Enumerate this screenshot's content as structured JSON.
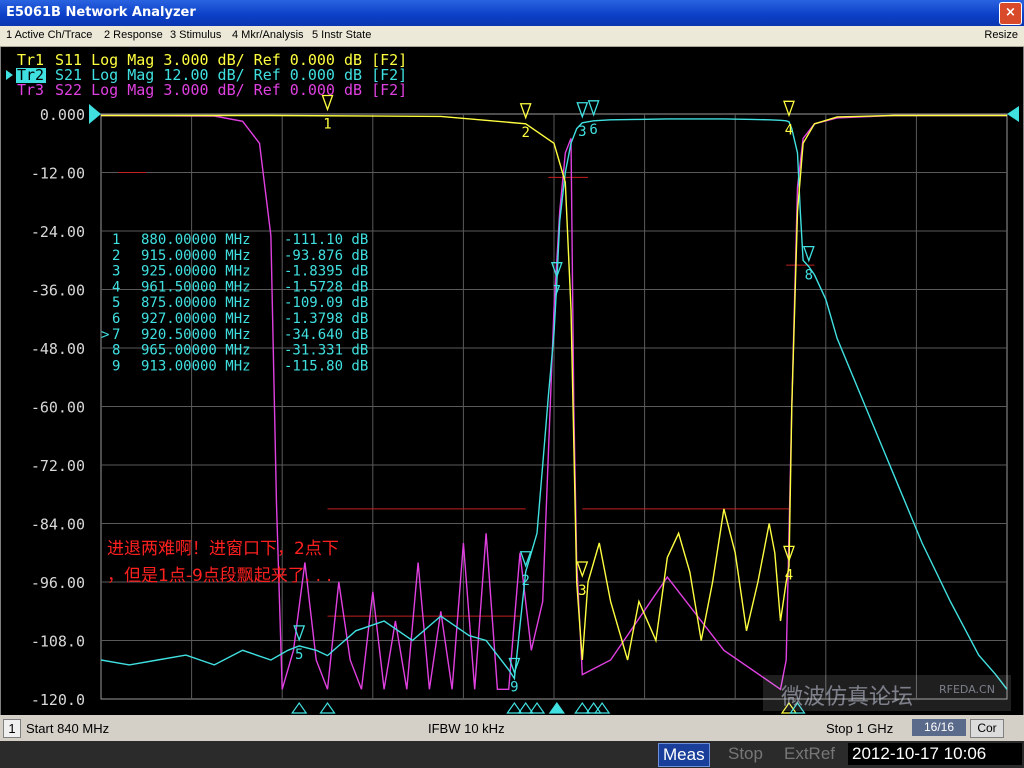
{
  "window": {
    "title": "E5061B Network Analyzer",
    "close_glyph": "×"
  },
  "menu": {
    "items": [
      "1 Active Ch/Trace",
      "2 Response",
      "3 Stimulus",
      "4 Mkr/Analysis",
      "5 Instr State"
    ],
    "resize": "Resize"
  },
  "traces": [
    {
      "id": "Tr1",
      "label": "Tr1 S11 Log Mag 3.000 dB/ Ref 0.000 dB [F2]",
      "color": "#ffff40",
      "active": false
    },
    {
      "id": "Tr2",
      "label": "Tr2 S21 Log Mag 12.00 dB/ Ref 0.000 dB [F2]",
      "color": "#40e0e0",
      "active": true
    },
    {
      "id": "Tr3",
      "label": "Tr3 S22 Log Mag 3.000 dB/ Ref 0.000 dB [F2]",
      "color": "#e040e0",
      "active": false
    }
  ],
  "annotation": {
    "line1": "进退两难啊！进窗口下，2点下",
    "line2": "，但是1点-9点段飘起来了. . .",
    "color": "#ff2020"
  },
  "marker_table": [
    {
      "num": "1",
      "freq": "880.00000 MHz",
      "value": "-111.10 dB",
      "active": false
    },
    {
      "num": "2",
      "freq": "915.00000 MHz",
      "value": "-93.876 dB",
      "active": false
    },
    {
      "num": "3",
      "freq": "925.00000 MHz",
      "value": "-1.8395 dB",
      "active": false
    },
    {
      "num": "4",
      "freq": "961.50000 MHz",
      "value": "-1.5728 dB",
      "active": false
    },
    {
      "num": "5",
      "freq": "875.00000 MHz",
      "value": "-109.09 dB",
      "active": false
    },
    {
      "num": "6",
      "freq": "927.00000 MHz",
      "value": "-1.3798 dB",
      "active": false
    },
    {
      "num": "7",
      "freq": "920.50000 MHz",
      "value": "-34.640 dB",
      "active": true
    },
    {
      "num": "8",
      "freq": "965.00000 MHz",
      "value": "-31.331 dB",
      "active": false
    },
    {
      "num": "9",
      "freq": "913.00000 MHz",
      "value": "-115.80 dB",
      "active": false
    }
  ],
  "channel_bar": {
    "channel": "1",
    "start": "Start 840 MHz",
    "ifbw": "IFBW 10 kHz",
    "stop": "Stop 1 GHz",
    "points": "16/16",
    "cor": "Cor"
  },
  "status_bar": {
    "meas": "Meas",
    "stop": "Stop",
    "extref": "ExtRef",
    "clock": "2012-10-17 10:06"
  },
  "watermark": {
    "text1": "微波仿真论坛",
    "text2": "RFEDA.CN"
  },
  "chart_data": {
    "type": "line",
    "xlim": [
      840,
      1000
    ],
    "x_unit": "MHz",
    "ylim": [
      -120,
      0
    ],
    "ytick_labels": [
      "0.000",
      "-12.00",
      "-24.00",
      "-36.00",
      "-48.00",
      "-60.00",
      "-72.00",
      "-84.00",
      "-96.00",
      "-108.0",
      "-120.0"
    ],
    "grid": true,
    "series": [
      {
        "name": "S21",
        "color": "#40e0e0",
        "x": [
          840,
          845,
          850,
          855,
          860,
          865,
          870,
          873,
          875,
          878,
          880,
          885,
          890,
          895,
          900,
          905,
          908,
          910,
          912,
          913,
          915,
          917,
          918,
          919,
          920,
          920.5,
          921,
          922,
          923,
          924,
          925,
          927,
          930,
          935,
          940,
          945,
          950,
          955,
          958,
          960,
          961,
          961.5,
          962,
          963,
          963.5,
          964,
          965,
          966,
          968,
          970,
          975,
          980,
          985,
          990,
          995,
          998,
          1000
        ],
        "y": [
          -112,
          -113,
          -112,
          -111,
          -113,
          -110,
          -112,
          -110,
          -109.1,
          -110,
          -111.1,
          -106,
          -104,
          -108,
          -103,
          -107,
          -108,
          -111,
          -114,
          -115.8,
          -93.9,
          -86,
          -72,
          -58,
          -45,
          -34.6,
          -22,
          -12,
          -6,
          -3,
          -1.8,
          -1.4,
          -1.2,
          -1.1,
          -1.0,
          -1.0,
          -1.0,
          -1.1,
          -1.2,
          -1.3,
          -1.4,
          -1.6,
          -3,
          -8,
          -20,
          -30,
          -31.3,
          -33,
          -38,
          -46,
          -60,
          -74,
          -88,
          -100,
          -111,
          -115,
          -118
        ]
      },
      {
        "name": "S11",
        "color": "#ffff40",
        "x": [
          840,
          870,
          900,
          915,
          920,
          922,
          923,
          924,
          925,
          926,
          928,
          930,
          933,
          935,
          938,
          940,
          942,
          944,
          946,
          948,
          950,
          952,
          954,
          956,
          958,
          959,
          960,
          961,
          961.5,
          962,
          963,
          964,
          966,
          970,
          980,
          1000
        ],
        "y": [
          -0.3,
          -0.3,
          -0.5,
          -2,
          -6,
          -14,
          -40,
          -96,
          -112,
          -96,
          -88,
          -100,
          -112,
          -100,
          -108,
          -91,
          -86,
          -94,
          -108,
          -96,
          -81,
          -90,
          -106,
          -96,
          -84,
          -90,
          -104,
          -96,
          -92.8,
          -60,
          -20,
          -6,
          -2,
          -0.6,
          -0.3,
          -0.3
        ]
      },
      {
        "name": "S22",
        "color": "#e040e0",
        "x": [
          840,
          860,
          865,
          868,
          870,
          871,
          872,
          874,
          876,
          878,
          880,
          882,
          884,
          886,
          888,
          890,
          892,
          894,
          896,
          898,
          900,
          902,
          904,
          906,
          908,
          910,
          912,
          914,
          916,
          918,
          919,
          920,
          921,
          922,
          923,
          923.5,
          924,
          925,
          930,
          940,
          950,
          960,
          961,
          962,
          963,
          964,
          966,
          970,
          980,
          1000
        ],
        "y": [
          -0.3,
          -0.4,
          -1.5,
          -6,
          -25,
          -80,
          -118,
          -110,
          -92,
          -112,
          -118,
          -96,
          -112,
          -118,
          -98,
          -118,
          -104,
          -118,
          -92,
          -118,
          -102,
          -118,
          -88,
          -118,
          -86,
          -118,
          -118,
          -90,
          -110,
          -100,
          -70,
          -40,
          -20,
          -8,
          -5,
          -60,
          -92,
          -115,
          -112,
          -95,
          -110,
          -118,
          -112,
          -60,
          -15,
          -5,
          -2,
          -0.8,
          -0.3,
          -0.3
        ]
      }
    ],
    "markers": [
      {
        "num": "1",
        "trace": "S11",
        "x": 880,
        "y": -0.3
      },
      {
        "num": "2",
        "trace": "S11",
        "x": 915,
        "y": -2
      },
      {
        "num": "4",
        "trace": "S11",
        "x": 961.5,
        "y": -1.5
      },
      {
        "num": "3",
        "trace": "S21",
        "x": 925,
        "y": -1.8
      },
      {
        "num": "6",
        "trace": "S21",
        "x": 927,
        "y": -1.4
      },
      {
        "num": "7",
        "trace": "S21",
        "x": 920.5,
        "y": -34.6
      },
      {
        "num": "8",
        "trace": "S21",
        "x": 965,
        "y": -31.3
      },
      {
        "num": "2",
        "trace": "S21",
        "x": 915,
        "y": -93.9
      },
      {
        "num": "5",
        "trace": "S21",
        "x": 875,
        "y": -109.1
      },
      {
        "num": "9",
        "trace": "S21",
        "x": 913,
        "y": -115.8
      },
      {
        "num": "3",
        "trace": "S11",
        "x": 925,
        "y": -96
      },
      {
        "num": "4",
        "trace": "S11",
        "x": 961.5,
        "y": -92.8
      }
    ],
    "limit_lines": [
      {
        "x1": 843,
        "x2": 848,
        "y": -12
      },
      {
        "x1": 919,
        "x2": 926,
        "y": -13
      },
      {
        "x1": 961,
        "x2": 966,
        "y": -31
      },
      {
        "x1": 880,
        "x2": 915,
        "y": -81
      },
      {
        "x1": 925,
        "x2": 961.5,
        "y": -81
      },
      {
        "x1": 880,
        "x2": 914,
        "y": -103
      }
    ]
  }
}
